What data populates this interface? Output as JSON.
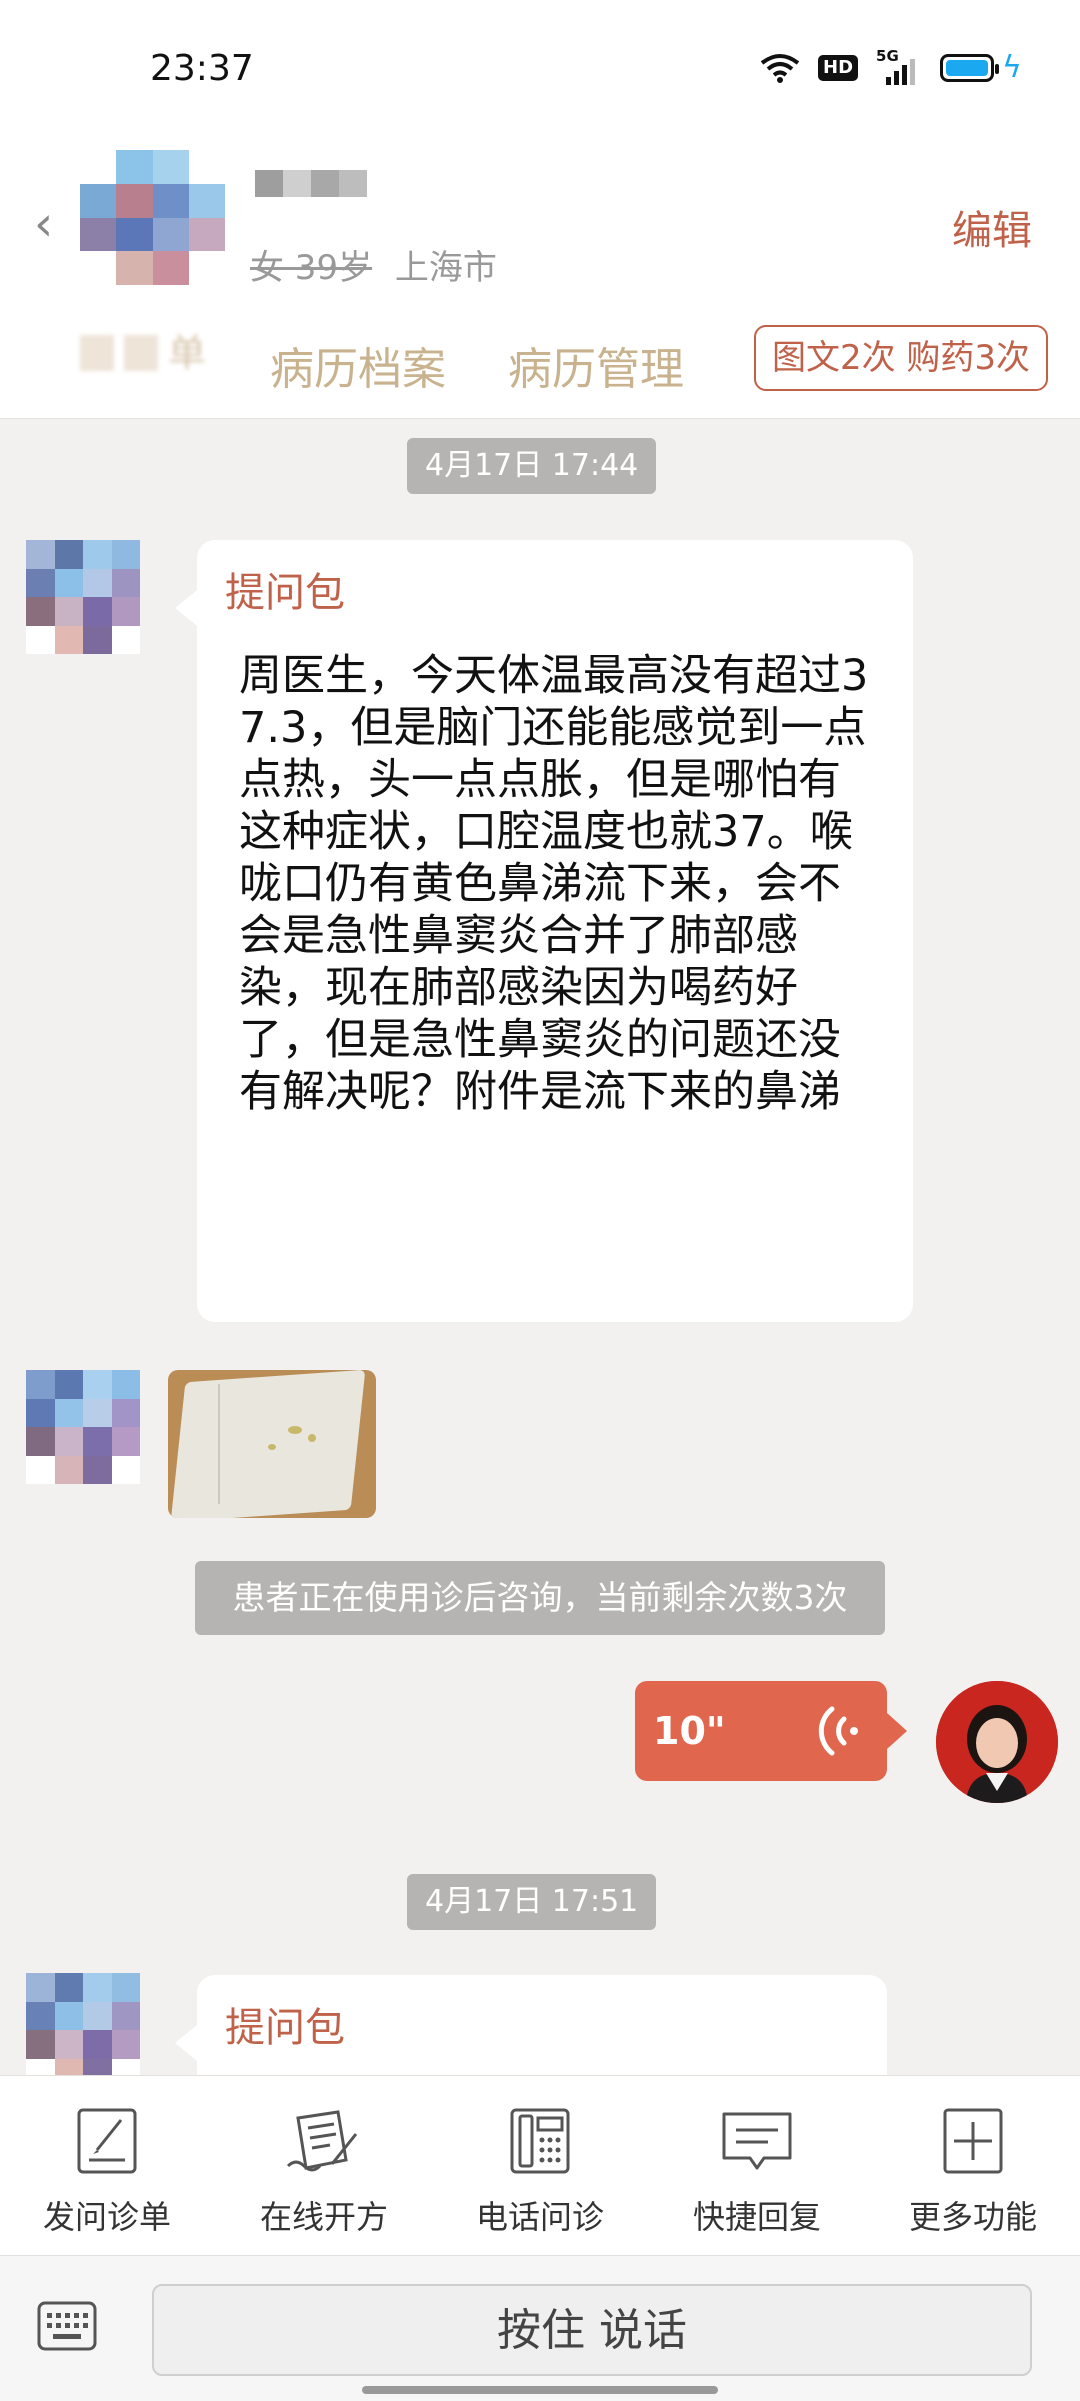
{
  "status_bar": {
    "time": "23:37",
    "hd": "HD",
    "network": "5G"
  },
  "header": {
    "patient_info": {
      "gender_age": "女 39岁",
      "city": "上海市"
    },
    "edit_label": "编辑",
    "tabs": [
      {
        "label": "病历档案"
      },
      {
        "label": "病历管理"
      }
    ],
    "blurred_tab_glyph": "单",
    "stats_badge": "图文2次 购药3次"
  },
  "chat": {
    "messages": [
      {
        "type": "timestamp",
        "text": "4月17日 17:44"
      },
      {
        "type": "question",
        "title": "提问包",
        "text": "周医生，今天体温最高没有超过37.3，但是脑门还能能感觉到一点点热，头一点点胀，但是哪怕有这种症状，口腔温度也就37。喉咙口仍有黄色鼻涕流下来，会不会是急性鼻窦炎合并了肺部感染，现在肺部感染因为喝药好了，但是急性鼻窦炎的问题还没有解决呢？附件是流下来的鼻涕"
      },
      {
        "type": "image"
      },
      {
        "type": "notice",
        "text": "患者正在使用诊后咨询，当前剩余次数3次"
      },
      {
        "type": "voice",
        "duration": "10\""
      },
      {
        "type": "timestamp",
        "text": "4月17日 17:51"
      },
      {
        "type": "question",
        "title": "提问包"
      }
    ]
  },
  "toolbar": {
    "items": [
      {
        "label": "发问诊单",
        "icon": "form-icon"
      },
      {
        "label": "在线开方",
        "icon": "prescription-icon"
      },
      {
        "label": "电话问诊",
        "icon": "phone-icon"
      },
      {
        "label": "快捷回复",
        "icon": "quick-reply-icon"
      },
      {
        "label": "更多功能",
        "icon": "plus-icon"
      }
    ]
  },
  "input_bar": {
    "hold_to_talk": "按住 说话"
  },
  "colors": {
    "accent": "#c0624a",
    "voice_bubble": "#e0674d",
    "tab_text": "#c9b28e",
    "pill": "#b6b4b2"
  }
}
